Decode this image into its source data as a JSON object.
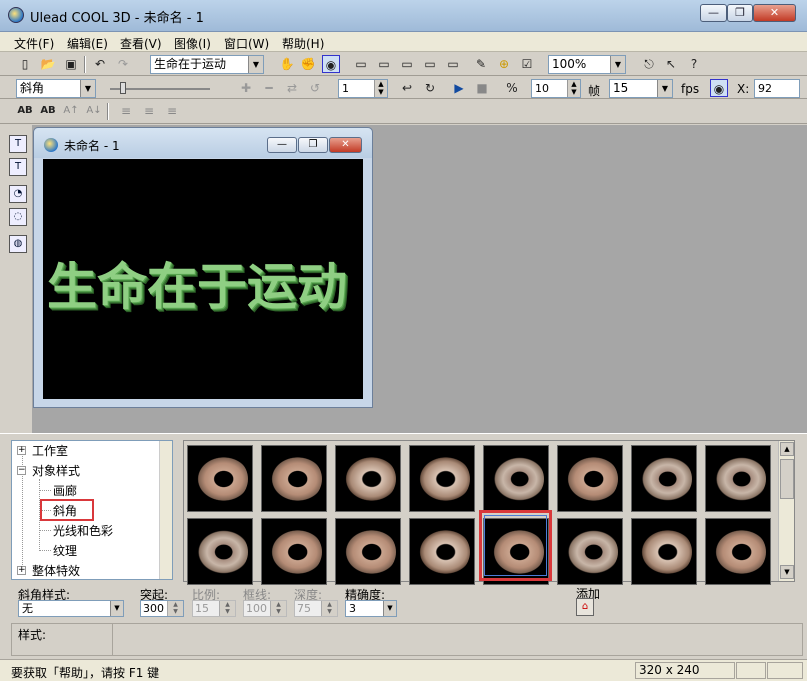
{
  "app": {
    "title": "Ulead COOL 3D - 未命名 - 1",
    "window_buttons": [
      "—",
      "❐",
      "✕"
    ]
  },
  "menu": [
    "文件(F)",
    "编辑(E)",
    "查看(V)",
    "图像(I)",
    "窗口(W)",
    "帮助(H)"
  ],
  "toolbar1": {
    "text_combo": "生命在于运动",
    "zoom_combo": "100%"
  },
  "toolbar2": {
    "object_combo": "斜角",
    "frame_value": "1",
    "frame_count": "10",
    "frame_label": "帧",
    "fps_value": "15",
    "fps_label": "fps",
    "x_label": "X:",
    "x_value": "92"
  },
  "toolbar3": {
    "btn1": "AB",
    "btn2": "AB",
    "btn3": "A↑",
    "btn4": "A↓"
  },
  "document": {
    "title": "未命名 - 1",
    "canvas_text": "生命在于运动",
    "text_color": "#8fcf83"
  },
  "tree": {
    "items": [
      {
        "label": "工作室",
        "expander": "+"
      },
      {
        "label": "对象样式",
        "expander": "−"
      },
      {
        "label": "画廊"
      },
      {
        "label": "斜角"
      },
      {
        "label": "光线和色彩"
      },
      {
        "label": "纹理"
      },
      {
        "label": "整体特效",
        "expander": "+"
      }
    ]
  },
  "props": {
    "bevel_style_label": "斜角样式:",
    "bevel_style_value": "无",
    "extrude_label": "突起:",
    "extrude_value": "300",
    "scale_label": "比例:",
    "scale_value": "15",
    "border_label": "框线:",
    "border_value": "100",
    "depth_label": "深度:",
    "depth_value": "75",
    "precision_label": "精确度:",
    "precision_value": "3",
    "add_label": "添加"
  },
  "style_label": "样式:",
  "status": {
    "help_text": "要获取「帮助」，请按 F1 键",
    "dimensions": "320 x 240"
  },
  "accent": "#d9383b"
}
